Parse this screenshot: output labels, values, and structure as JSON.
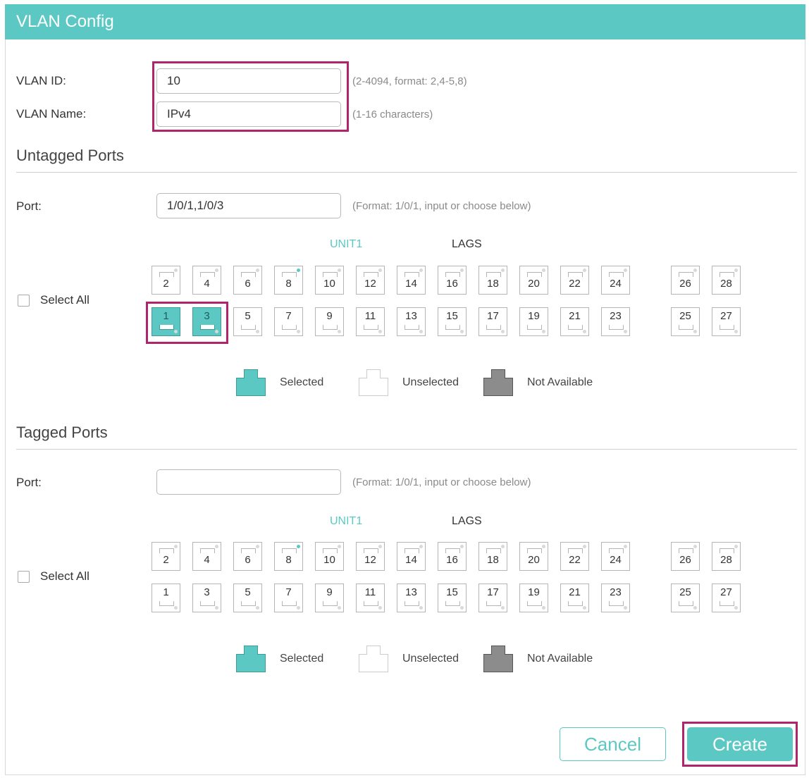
{
  "window": {
    "title": "VLAN Config"
  },
  "vlan": {
    "id_label": "VLAN ID:",
    "id_value": "10",
    "id_hint": "(2-4094, format: 2,4-5,8)",
    "name_label": "VLAN Name:",
    "name_value": "IPv4",
    "name_hint": "(1-16 characters)"
  },
  "untagged": {
    "title": "Untagged Ports",
    "port_label": "Port:",
    "port_value": "1/0/1,1/0/3",
    "port_hint": "(Format: 1/0/1, input or choose below)",
    "unit_label": "UNIT1",
    "lags_label": "LAGS",
    "select_all_label": "Select All",
    "selected_ports": [
      "1",
      "3"
    ]
  },
  "tagged": {
    "title": "Tagged Ports",
    "port_label": "Port:",
    "port_value": "",
    "port_hint": "(Format: 1/0/1, input or choose below)",
    "unit_label": "UNIT1",
    "lags_label": "LAGS",
    "select_all_label": "Select All",
    "selected_ports": []
  },
  "ports": {
    "top_row": [
      "2",
      "4",
      "6",
      "8",
      "10",
      "12",
      "14",
      "16",
      "18",
      "20",
      "22",
      "24",
      "26",
      "28"
    ],
    "bottom_row": [
      "1",
      "3",
      "5",
      "7",
      "9",
      "11",
      "13",
      "15",
      "17",
      "19",
      "21",
      "23",
      "25",
      "27"
    ],
    "active_indicator_port": "8"
  },
  "legend": {
    "selected": "Selected",
    "unselected": "Unselected",
    "not_available": "Not Available"
  },
  "buttons": {
    "cancel": "Cancel",
    "create": "Create"
  },
  "colors": {
    "accent": "#5cc8c4",
    "highlight": "#b0246b",
    "not_available": "#8c8c8c",
    "unselected": "#ffffff"
  }
}
